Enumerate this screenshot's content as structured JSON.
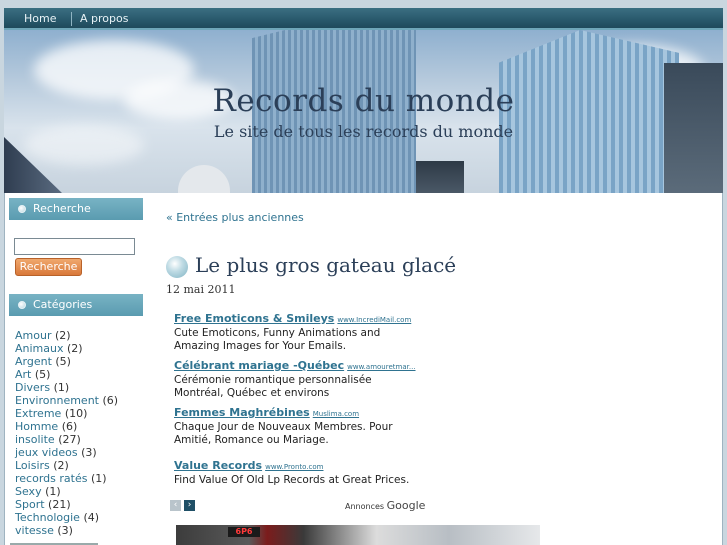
{
  "nav": {
    "items": [
      {
        "label": "Home"
      },
      {
        "label": "A propos"
      }
    ]
  },
  "header": {
    "title": "Records du monde",
    "tagline": "Le site de tous les records du monde"
  },
  "sidebar": {
    "search": {
      "title": "Recherche",
      "button_label": "Recherche",
      "value": ""
    },
    "categories": {
      "title": "Catégories",
      "items": [
        {
          "name": "Amour",
          "count": "(2)"
        },
        {
          "name": "Animaux",
          "count": "(2)"
        },
        {
          "name": "Argent",
          "count": "(5)"
        },
        {
          "name": "Art",
          "count": "(5)"
        },
        {
          "name": "Divers",
          "count": "(1)"
        },
        {
          "name": "Environnement",
          "count": "(6)"
        },
        {
          "name": "Extreme",
          "count": "(10)"
        },
        {
          "name": "Homme",
          "count": "(6)"
        },
        {
          "name": "insolite",
          "count": "(27)"
        },
        {
          "name": "jeux videos",
          "count": "(3)"
        },
        {
          "name": "Loisirs",
          "count": "(2)"
        },
        {
          "name": "records ratés",
          "count": "(1)"
        },
        {
          "name": "Sexy",
          "count": "(1)"
        },
        {
          "name": "Sport",
          "count": "(21)"
        },
        {
          "name": "Technologie",
          "count": "(4)"
        },
        {
          "name": "vitesse",
          "count": "(3)"
        }
      ]
    }
  },
  "main": {
    "older_link": "« Entrées plus anciennes",
    "post": {
      "title": "Le plus gros gateau glacé",
      "date": "12 mai 2011"
    },
    "ads": [
      {
        "title": "Free Emoticons & Smileys",
        "url": "www.IncrediMail.com",
        "desc": "Cute Emoticons, Funny Animations and Amazing Images for Your Emails."
      },
      {
        "title": "Célébrant mariage -Québec",
        "url": "www.amouretmar...",
        "desc": "Cérémonie romantique personnalisée Montréal, Québec et environs"
      },
      {
        "title": "Femmes Maghrébines",
        "url": "Muslima.com",
        "desc": "Chaque Jour de Nouveaux Membres. Pour Amitié, Romance ou Mariage."
      },
      {
        "title": "Value Records",
        "url": "www.Pronto.com",
        "desc": "Find Value Of Old Lp Records at Great Prices."
      }
    ],
    "ads_label_prefix": "Annonces",
    "ads_label_brand": "Google",
    "ads_prev": "‹",
    "ads_next": "›",
    "photo_sign": "6P6"
  }
}
